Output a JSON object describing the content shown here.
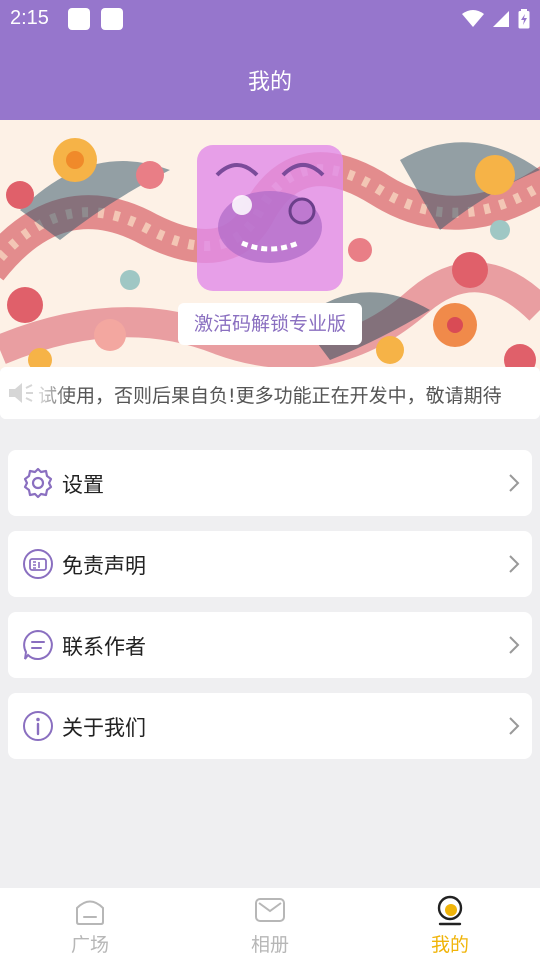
{
  "status_bar": {
    "time": "2:15"
  },
  "app_bar": {
    "title": "我的"
  },
  "banner": {
    "activate_label": "激活码解锁专业版"
  },
  "notice": {
    "text": "试使用，否则后果自负!更多功能正在开发中，敬请期待"
  },
  "menu": [
    {
      "label": "设置",
      "icon": "gear-icon"
    },
    {
      "label": "免责声明",
      "icon": "disclaimer-icon"
    },
    {
      "label": "联系作者",
      "icon": "chat-icon"
    },
    {
      "label": "关于我们",
      "icon": "info-icon"
    }
  ],
  "tabs": [
    {
      "label": "广场",
      "icon": "home-icon",
      "active": false
    },
    {
      "label": "相册",
      "icon": "mail-icon",
      "active": false
    },
    {
      "label": "我的",
      "icon": "profile-icon",
      "active": true
    }
  ],
  "colors": {
    "accent": "#9676cc",
    "active_tab": "#f0b40a",
    "icon": "#8a6fc0"
  }
}
